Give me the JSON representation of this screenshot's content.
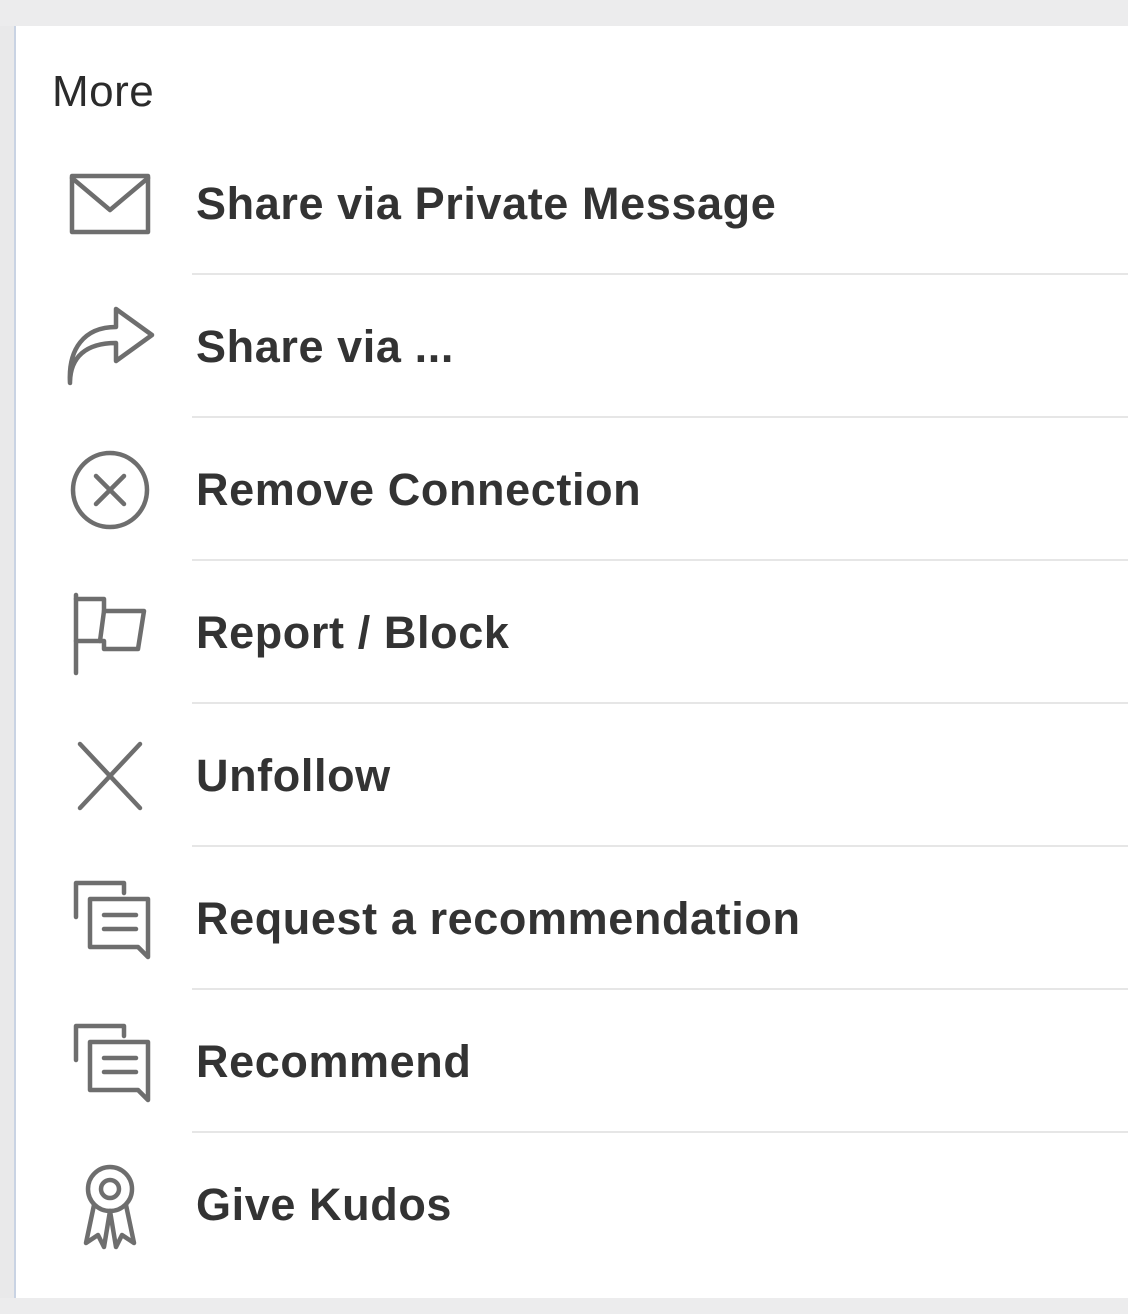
{
  "menu": {
    "title": "More",
    "items": [
      {
        "label": "Share via Private Message",
        "icon": "envelope-icon"
      },
      {
        "label": "Share via ...",
        "icon": "share-arrow-icon"
      },
      {
        "label": "Remove Connection",
        "icon": "circle-x-icon"
      },
      {
        "label": "Report / Block",
        "icon": "flag-icon"
      },
      {
        "label": "Unfollow",
        "icon": "x-icon"
      },
      {
        "label": "Request a recommendation",
        "icon": "chat-bubbles-icon"
      },
      {
        "label": "Recommend",
        "icon": "chat-bubbles-icon"
      },
      {
        "label": "Give Kudos",
        "icon": "award-ribbon-icon"
      }
    ]
  },
  "colors": {
    "text": "#333333",
    "icon": "#6e6e6e",
    "divider": "#e6e6e6",
    "background": "#ffffff"
  }
}
